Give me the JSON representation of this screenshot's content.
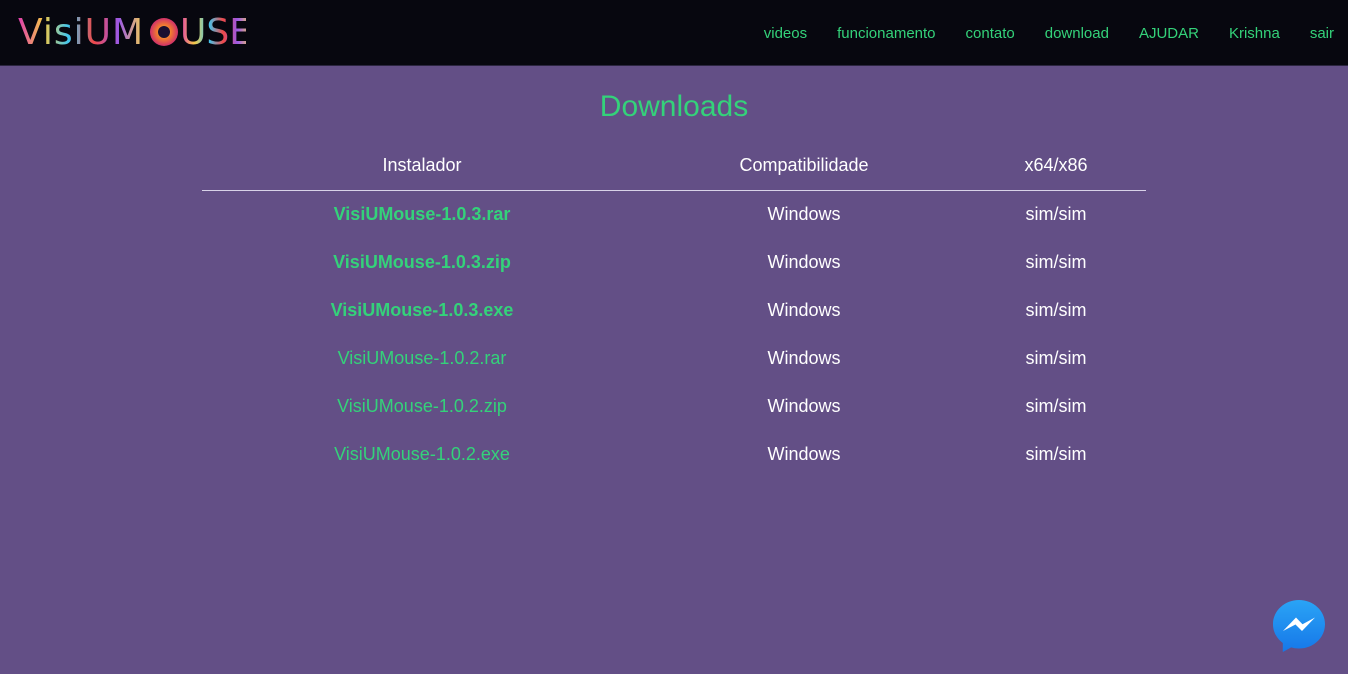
{
  "navbar": {
    "logo_alt": "VisiUMouse",
    "links": [
      {
        "label": "videos"
      },
      {
        "label": "funcionamento"
      },
      {
        "label": "contato"
      },
      {
        "label": "download"
      },
      {
        "label": "AJUDAR"
      },
      {
        "label": "Krishna"
      },
      {
        "label": "sair"
      }
    ]
  },
  "main": {
    "title": "Downloads",
    "table": {
      "headers": [
        "Instalador",
        "Compatibilidade",
        "x64/x86"
      ],
      "rows": [
        {
          "file": "VisiUMouse-1.0.3.rar",
          "compat": "Windows",
          "arch": "sim/sim",
          "bold": true
        },
        {
          "file": "VisiUMouse-1.0.3.zip",
          "compat": "Windows",
          "arch": "sim/sim",
          "bold": true
        },
        {
          "file": "VisiUMouse-1.0.3.exe",
          "compat": "Windows",
          "arch": "sim/sim",
          "bold": true
        },
        {
          "file": "VisiUMouse-1.0.2.rar",
          "compat": "Windows",
          "arch": "sim/sim",
          "bold": false
        },
        {
          "file": "VisiUMouse-1.0.2.zip",
          "compat": "Windows",
          "arch": "sim/sim",
          "bold": false
        },
        {
          "file": "VisiUMouse-1.0.2.exe",
          "compat": "Windows",
          "arch": "sim/sim",
          "bold": false
        }
      ]
    }
  },
  "colors": {
    "background": "#634f86",
    "navbar": "#07070f",
    "accent_green": "#34d27a",
    "text": "#ffffff",
    "messenger_blue": "#1e8ff5"
  },
  "icons": {
    "chat": "messenger-icon"
  }
}
